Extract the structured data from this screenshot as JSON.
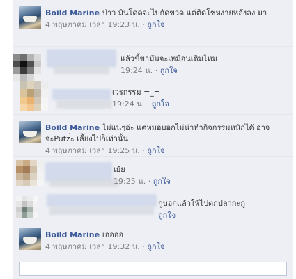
{
  "comments": [
    {
      "author": "Boild Marine",
      "text": "ป่าว มันโดดจะไปกัดขวด แต่ติดโซ่หงายหลังลง มา",
      "time": "4 พฤษภาคม เวลา 19:23 น.",
      "like": "ถูกใจ",
      "sep": " · "
    },
    {
      "author": "",
      "text": "แล้วขี้ขามันจะเหมือนเดิมไหม",
      "time": "19:24 น.",
      "like": "ถูกใจ",
      "sep": " · "
    },
    {
      "author": "",
      "text": "เวรกรรม =_=",
      "time": "19:24 น.",
      "like": "ถูกใจ",
      "sep": " · "
    },
    {
      "author": "Boild Marine",
      "text": "ไม่แน่ๆอ่ะ แต่หมอบอกไม่น่าทำกิจกรรมหนักได้ อาจจะPutz่ะ เลี้ยงไปก็เท่านั้น",
      "time": "4 พฤษภาคม เวลา 19:25 น.",
      "like": "ถูกใจ",
      "sep": " · "
    },
    {
      "author": "",
      "text": "เย้ย",
      "time": "19:25 น.",
      "like": "ถูกใจ",
      "sep": " · "
    },
    {
      "author": "",
      "text": "กูบอกแล้วให้ไปตกปลากะกู",
      "time": "",
      "like": "ถูกใจ",
      "sep": ""
    },
    {
      "author": "Boild Marine",
      "text": "เออออ",
      "time": "4 พฤษภาคม เวลา 19:32 น.",
      "like": "ถูกใจ",
      "sep": " · "
    }
  ],
  "reply_box": {
    "placeholder": ""
  },
  "colors": {
    "link": "#3b5998",
    "background": "#edeff4",
    "meta": "#7f7f7f"
  }
}
